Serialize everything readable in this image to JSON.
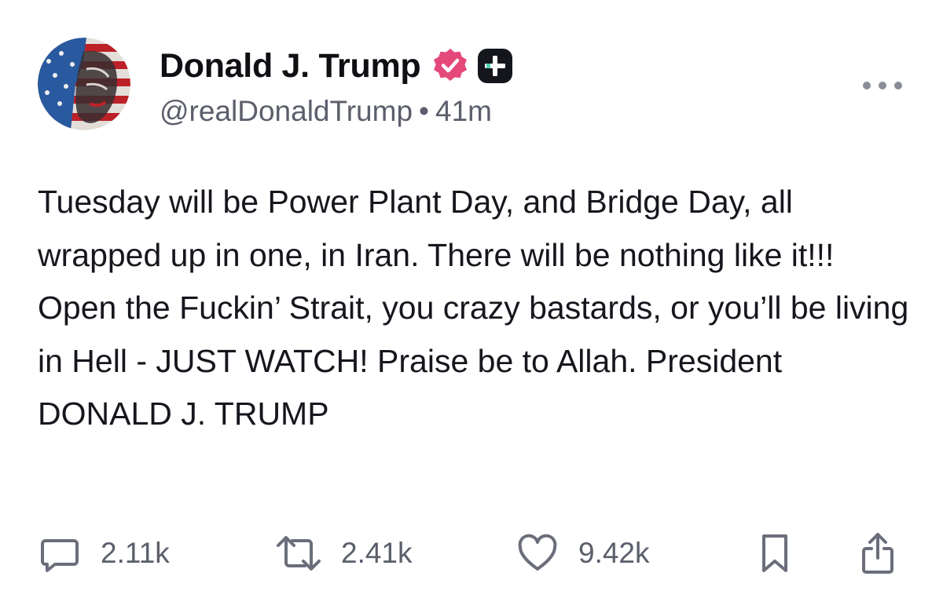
{
  "author": {
    "display_name": "Donald J. Trump",
    "handle": "@realDonaldTrump",
    "separator": "•",
    "time_ago": "41m",
    "verified_icon": "verified-badge-icon",
    "plus_icon": "plus-badge-icon",
    "avatar": "profile-avatar"
  },
  "post": {
    "text": "Tuesday will be Power Plant Day, and Bridge Day, all wrapped up in one, in Iran. There will be nothing like it!!! Open the Fuckin’ Strait, you crazy bastards, or you’ll be living in Hell - JUST WATCH! Praise be to Allah. President DONALD J. TRUMP"
  },
  "actions": {
    "replies": "2.11k",
    "reposts": "2.41k",
    "likes": "9.42k"
  },
  "colors": {
    "text": "#0f0f14",
    "muted": "#5b5e6b",
    "verified": "#e5487a",
    "badge": "#14161c"
  }
}
